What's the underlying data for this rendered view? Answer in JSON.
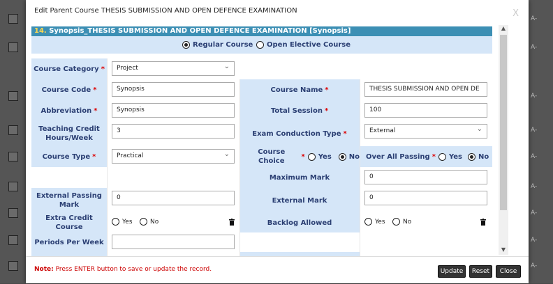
{
  "modal": {
    "title": "Edit Parent Course THESIS SUBMISSION AND OPEN DEFENCE EXAMINATION",
    "close_label": "X",
    "section_number": "14.",
    "section_title": "Synopsis_THESIS SUBMISSION AND OPEN DEFENCE EXAMINATION [Synopsis]"
  },
  "course_mode": {
    "options": [
      "Regular Course",
      "Open Elective Course"
    ],
    "selected": "Regular Course"
  },
  "form": {
    "course_category": {
      "label": "Course Category",
      "value": "Project"
    },
    "course_code": {
      "label": "Course Code",
      "value": "Synopsis"
    },
    "course_name": {
      "label": "Course Name",
      "value": "THESIS SUBMISSION AND OPEN DE"
    },
    "abbreviation": {
      "label": "Abbreviation",
      "value": "Synopsis"
    },
    "total_session": {
      "label": "Total Session",
      "value": "100"
    },
    "teaching_credit": {
      "label": "Teaching Credit Hours/Week",
      "value": "3"
    },
    "exam_conduction_type": {
      "label": "Exam Conduction Type",
      "value": "External"
    },
    "course_type": {
      "label": "Course Type",
      "value": "Practical"
    },
    "course_choice": {
      "label": "Course Choice",
      "yes": "Yes",
      "no": "No",
      "selected": "No"
    },
    "overall_passing": {
      "label": "Over All Passing",
      "yes": "Yes",
      "no": "No",
      "selected": "No"
    },
    "maximum_mark": {
      "label": "Maximum Mark",
      "value": "0"
    },
    "external_passing_mark": {
      "label": "External Passing Mark",
      "value": "0"
    },
    "external_mark": {
      "label": "External Mark",
      "value": "0"
    },
    "extra_credit_course": {
      "label": "Extra Credit Course",
      "yes": "Yes",
      "no": "No"
    },
    "backlog_allowed": {
      "label": "Backlog Allowed",
      "yes": "Yes",
      "no": "No"
    },
    "periods_per_week": {
      "label": "Periods Per Week",
      "value": ""
    },
    "required_mark": "*"
  },
  "footer": {
    "note_prefix": "Note:",
    "note_text": " Press ENTER button to save or update the record.",
    "update_label": "Update",
    "reset_label": "Reset",
    "close_label": "Close"
  },
  "background": {
    "row_suffix": "A-"
  },
  "colors": {
    "header_bar": "#3c8fb4",
    "label_bg": "#d5e6f8",
    "label_text": "#2b3f73",
    "required": "#dd0000",
    "note": "#cc0000"
  }
}
